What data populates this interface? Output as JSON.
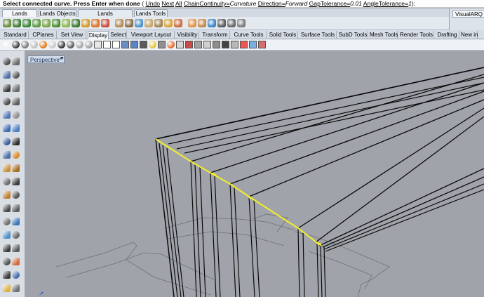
{
  "command_line": {
    "prompt": "Select connected curve. Press Enter when done",
    "paren_open": "(",
    "opt_undo": "Undo",
    "opt_next": "Next",
    "opt_all": "All",
    "opt_chain_key": "ChainContinuity=",
    "opt_chain_val": "Curvature",
    "opt_dir_key": "Direction=",
    "opt_dir_val": "Forward",
    "opt_gap_key": "GapTolerance=",
    "opt_gap_val": "0.01",
    "opt_angle_key": "AngleTolerance=",
    "opt_angle_val": "1",
    "paren_close": ")",
    "colon": ":"
  },
  "top_tabs": [
    "Lands Design",
    "Lands Objects",
    "Lands Documentation",
    "Lands Tools"
  ],
  "visualarq_title": "VisualARQ Ol",
  "main_tabs": [
    "Standard",
    "CPlanes",
    "Set View",
    "Display",
    "Select",
    "Viewport Layout",
    "Visibility",
    "Transform",
    "Curve Tools",
    "Solid Tools",
    "Surface Tools",
    "SubD Tools",
    "Mesh Tools",
    "Render Tools",
    "Drafting",
    "New in"
  ],
  "active_main_tab": "Display",
  "viewport": {
    "title": "Perspective*",
    "menu_arrow": "▼"
  },
  "icons": {
    "row1": [
      "lands-terrain-icon",
      "lands-plant-icon",
      "lands-tree-icon",
      "lands-shrub-icon",
      "lands-planting-icon",
      "lands-hedge-icon",
      "lands-grass-icon",
      "lands-tree-row-icon",
      "lands-palm-icon",
      "lands-flower-icon",
      "lands-pavement-icon",
      "lands-wall-icon",
      "lands-fence-icon",
      "lands-pool-icon",
      "lands-path-icon",
      "lands-stair-icon",
      "lands-building-icon",
      "lands-label-icon",
      "lands-section-icon",
      "lands-elevation-icon",
      "lands-profile-icon",
      "lands-terrain-profile-icon",
      "lands-measure-icon",
      "lands-options-icon"
    ],
    "row2": [
      "wireframe-sphere-icon",
      "shaded-sphere-icon",
      "rendered-sphere-icon",
      "ghosted-sphere-icon",
      "xray-sphere-icon",
      "technical-sphere-icon",
      "artistic-sphere-icon",
      "pen-sphere-icon",
      "arctic-sphere-icon",
      "raytraced-sphere-icon",
      "display-settings-icon",
      "view-capture-icon",
      "capture-clipboard-icon",
      "named-views-icon",
      "named-positions-icon",
      "camera-icon",
      "sun-icon",
      "ground-plane-icon",
      "lights-icon",
      "section-icon",
      "clipping-plane-icon",
      "isocurve-icon",
      "edges-icon",
      "mesh-display-icon",
      "monitor-icon",
      "zebra-icon",
      "draft-angle-icon",
      "curvature-icon",
      "color-grid-icon"
    ],
    "left": [
      "select-icon",
      "point-icon",
      "polyline-icon",
      "arc-icon",
      "curve-icon",
      "rectangle-icon",
      "circle-icon",
      "polygon-icon",
      "surface-icon",
      "plane-icon",
      "extrude-icon",
      "loft-icon",
      "box-icon",
      "sphere-icon",
      "cylinder-icon",
      "boolean-icon",
      "move-icon",
      "copy-icon",
      "rotate-icon",
      "scale-icon",
      "fillet-icon",
      "trim-icon",
      "split-icon",
      "join-icon",
      "explode-icon",
      "group-icon",
      "mirror-icon",
      "array-icon",
      "text-icon",
      "dimension-icon",
      "hatch-icon",
      "block-icon",
      "check-icon",
      "analyze-icon",
      "layer-icon",
      "properties-icon"
    ]
  },
  "colors": {
    "viewport_bg": "#a0a4aa",
    "selection_highlight": "#f4ee2a",
    "curve_black": "#0a0a0a",
    "grid_gray": "#6e7278"
  }
}
